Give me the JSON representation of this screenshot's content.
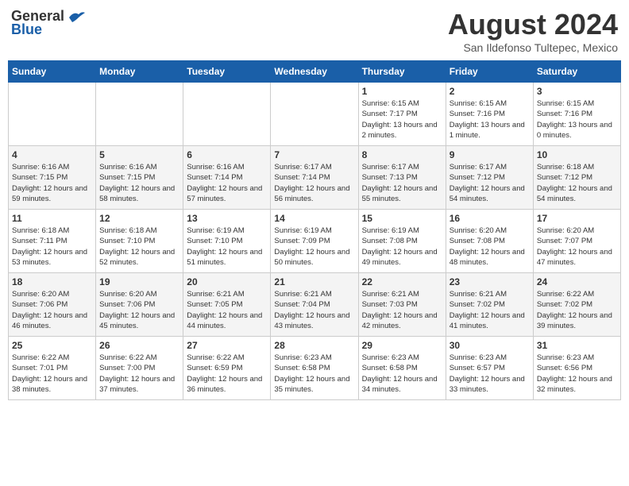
{
  "header": {
    "logo_general": "General",
    "logo_blue": "Blue",
    "month_year": "August 2024",
    "location": "San Ildefonso Tultepec, Mexico"
  },
  "days_of_week": [
    "Sunday",
    "Monday",
    "Tuesday",
    "Wednesday",
    "Thursday",
    "Friday",
    "Saturday"
  ],
  "weeks": [
    [
      {
        "day": "",
        "sunrise": "",
        "sunset": "",
        "daylight": ""
      },
      {
        "day": "",
        "sunrise": "",
        "sunset": "",
        "daylight": ""
      },
      {
        "day": "",
        "sunrise": "",
        "sunset": "",
        "daylight": ""
      },
      {
        "day": "",
        "sunrise": "",
        "sunset": "",
        "daylight": ""
      },
      {
        "day": "1",
        "sunrise": "Sunrise: 6:15 AM",
        "sunset": "Sunset: 7:17 PM",
        "daylight": "Daylight: 13 hours and 2 minutes."
      },
      {
        "day": "2",
        "sunrise": "Sunrise: 6:15 AM",
        "sunset": "Sunset: 7:16 PM",
        "daylight": "Daylight: 13 hours and 1 minute."
      },
      {
        "day": "3",
        "sunrise": "Sunrise: 6:15 AM",
        "sunset": "Sunset: 7:16 PM",
        "daylight": "Daylight: 13 hours and 0 minutes."
      }
    ],
    [
      {
        "day": "4",
        "sunrise": "Sunrise: 6:16 AM",
        "sunset": "Sunset: 7:15 PM",
        "daylight": "Daylight: 12 hours and 59 minutes."
      },
      {
        "day": "5",
        "sunrise": "Sunrise: 6:16 AM",
        "sunset": "Sunset: 7:15 PM",
        "daylight": "Daylight: 12 hours and 58 minutes."
      },
      {
        "day": "6",
        "sunrise": "Sunrise: 6:16 AM",
        "sunset": "Sunset: 7:14 PM",
        "daylight": "Daylight: 12 hours and 57 minutes."
      },
      {
        "day": "7",
        "sunrise": "Sunrise: 6:17 AM",
        "sunset": "Sunset: 7:14 PM",
        "daylight": "Daylight: 12 hours and 56 minutes."
      },
      {
        "day": "8",
        "sunrise": "Sunrise: 6:17 AM",
        "sunset": "Sunset: 7:13 PM",
        "daylight": "Daylight: 12 hours and 55 minutes."
      },
      {
        "day": "9",
        "sunrise": "Sunrise: 6:17 AM",
        "sunset": "Sunset: 7:12 PM",
        "daylight": "Daylight: 12 hours and 54 minutes."
      },
      {
        "day": "10",
        "sunrise": "Sunrise: 6:18 AM",
        "sunset": "Sunset: 7:12 PM",
        "daylight": "Daylight: 12 hours and 54 minutes."
      }
    ],
    [
      {
        "day": "11",
        "sunrise": "Sunrise: 6:18 AM",
        "sunset": "Sunset: 7:11 PM",
        "daylight": "Daylight: 12 hours and 53 minutes."
      },
      {
        "day": "12",
        "sunrise": "Sunrise: 6:18 AM",
        "sunset": "Sunset: 7:10 PM",
        "daylight": "Daylight: 12 hours and 52 minutes."
      },
      {
        "day": "13",
        "sunrise": "Sunrise: 6:19 AM",
        "sunset": "Sunset: 7:10 PM",
        "daylight": "Daylight: 12 hours and 51 minutes."
      },
      {
        "day": "14",
        "sunrise": "Sunrise: 6:19 AM",
        "sunset": "Sunset: 7:09 PM",
        "daylight": "Daylight: 12 hours and 50 minutes."
      },
      {
        "day": "15",
        "sunrise": "Sunrise: 6:19 AM",
        "sunset": "Sunset: 7:08 PM",
        "daylight": "Daylight: 12 hours and 49 minutes."
      },
      {
        "day": "16",
        "sunrise": "Sunrise: 6:20 AM",
        "sunset": "Sunset: 7:08 PM",
        "daylight": "Daylight: 12 hours and 48 minutes."
      },
      {
        "day": "17",
        "sunrise": "Sunrise: 6:20 AM",
        "sunset": "Sunset: 7:07 PM",
        "daylight": "Daylight: 12 hours and 47 minutes."
      }
    ],
    [
      {
        "day": "18",
        "sunrise": "Sunrise: 6:20 AM",
        "sunset": "Sunset: 7:06 PM",
        "daylight": "Daylight: 12 hours and 46 minutes."
      },
      {
        "day": "19",
        "sunrise": "Sunrise: 6:20 AM",
        "sunset": "Sunset: 7:06 PM",
        "daylight": "Daylight: 12 hours and 45 minutes."
      },
      {
        "day": "20",
        "sunrise": "Sunrise: 6:21 AM",
        "sunset": "Sunset: 7:05 PM",
        "daylight": "Daylight: 12 hours and 44 minutes."
      },
      {
        "day": "21",
        "sunrise": "Sunrise: 6:21 AM",
        "sunset": "Sunset: 7:04 PM",
        "daylight": "Daylight: 12 hours and 43 minutes."
      },
      {
        "day": "22",
        "sunrise": "Sunrise: 6:21 AM",
        "sunset": "Sunset: 7:03 PM",
        "daylight": "Daylight: 12 hours and 42 minutes."
      },
      {
        "day": "23",
        "sunrise": "Sunrise: 6:21 AM",
        "sunset": "Sunset: 7:02 PM",
        "daylight": "Daylight: 12 hours and 41 minutes."
      },
      {
        "day": "24",
        "sunrise": "Sunrise: 6:22 AM",
        "sunset": "Sunset: 7:02 PM",
        "daylight": "Daylight: 12 hours and 39 minutes."
      }
    ],
    [
      {
        "day": "25",
        "sunrise": "Sunrise: 6:22 AM",
        "sunset": "Sunset: 7:01 PM",
        "daylight": "Daylight: 12 hours and 38 minutes."
      },
      {
        "day": "26",
        "sunrise": "Sunrise: 6:22 AM",
        "sunset": "Sunset: 7:00 PM",
        "daylight": "Daylight: 12 hours and 37 minutes."
      },
      {
        "day": "27",
        "sunrise": "Sunrise: 6:22 AM",
        "sunset": "Sunset: 6:59 PM",
        "daylight": "Daylight: 12 hours and 36 minutes."
      },
      {
        "day": "28",
        "sunrise": "Sunrise: 6:23 AM",
        "sunset": "Sunset: 6:58 PM",
        "daylight": "Daylight: 12 hours and 35 minutes."
      },
      {
        "day": "29",
        "sunrise": "Sunrise: 6:23 AM",
        "sunset": "Sunset: 6:58 PM",
        "daylight": "Daylight: 12 hours and 34 minutes."
      },
      {
        "day": "30",
        "sunrise": "Sunrise: 6:23 AM",
        "sunset": "Sunset: 6:57 PM",
        "daylight": "Daylight: 12 hours and 33 minutes."
      },
      {
        "day": "31",
        "sunrise": "Sunrise: 6:23 AM",
        "sunset": "Sunset: 6:56 PM",
        "daylight": "Daylight: 12 hours and 32 minutes."
      }
    ]
  ]
}
